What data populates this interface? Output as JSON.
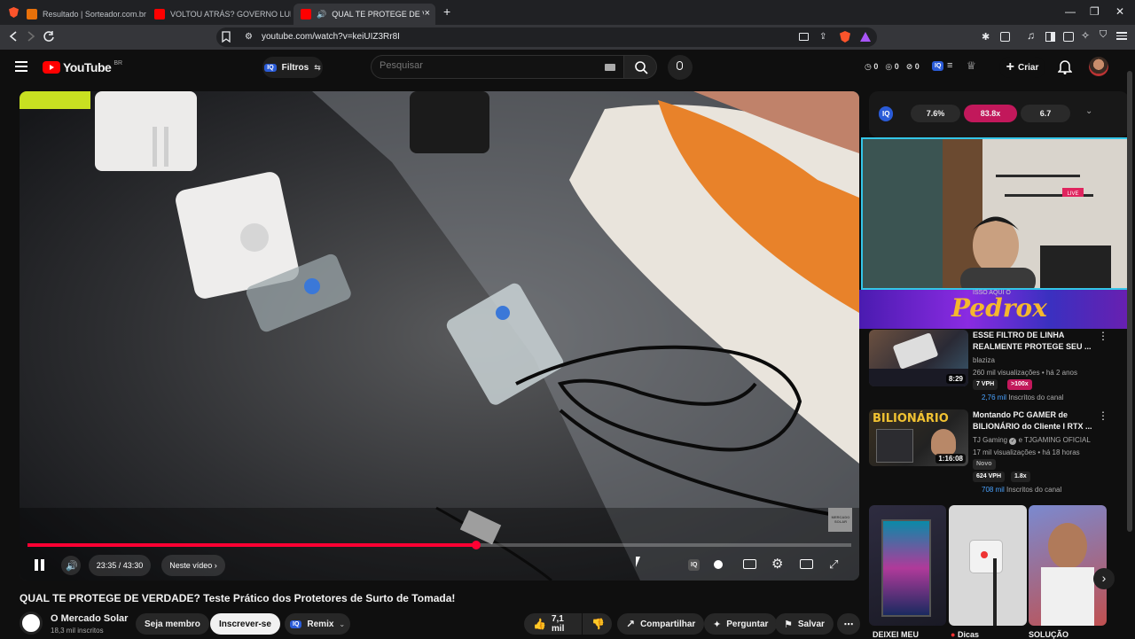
{
  "browser": {
    "tabs": [
      {
        "title": "Resultado | Sorteador.com.br - O Site",
        "active": false
      },
      {
        "title": "VOLTOU ATRÁS? GOVERNO LULA ZE",
        "active": false
      },
      {
        "title": "QUAL TE PROTEGE DE VERDA",
        "active": true
      }
    ],
    "new_tab_symbol": "+",
    "url": "youtube.com/watch?v=keiUIZ3Rr8I"
  },
  "header": {
    "logo_text": "YouTube",
    "country": "BR",
    "filters_badge": "IQ",
    "filters_label": "Filtros",
    "search_placeholder": "Pesquisar",
    "stats": [
      "0",
      "0",
      "0"
    ],
    "ext_badge": "IQ",
    "create_label": "Criar"
  },
  "video": {
    "time": "23:35 / 43:30",
    "progress": 0.545,
    "next_label": "Neste vídeo",
    "channel_watermark": "MERCADO SOLAR",
    "iq_badge": "IQ"
  },
  "below_video": {
    "title": "QUAL TE PROTEGE DE VERDADE? Teste Prático dos Protetores de Surto de Tomada!",
    "channel": "O Mercado Solar",
    "subs": "18,3 mil inscritos",
    "join_label": "Seja membro",
    "subscribe_label": "Inscrever-se",
    "remix_badge": "IQ",
    "remix_label": "Remix",
    "likes": "7,1 mil",
    "share_label": "Compartilhar",
    "ask_label": "Perguntar",
    "save_label": "Salvar"
  },
  "sidebar": {
    "iq_badge": "IQ",
    "metrics": [
      "7.6%",
      "83.8x",
      "6.7"
    ],
    "banner_text": "Pedrox",
    "banner_overlay": "ISSO AQUI O",
    "recommendations": [
      {
        "title": "ESSE FILTRO DE LINHA REALMENTE PROTEGE SEU ...",
        "channel": "blaziza",
        "meta": "260 mil visualizações • há 2 anos",
        "duration": "8:29",
        "vph": "7 VPH",
        "ratio": ">100x",
        "subs_value": "2,76 mil",
        "subs_label": " Inscritos do canal"
      },
      {
        "title": "Montando PC GAMER de BILIONÁRIO do Cliente I RTX ...",
        "channel": "TJ Gaming",
        "channel_extra": "e TJGAMING OFICIAL",
        "meta": "17 mil visualizações • há 18 horas",
        "duration": "1:16:08",
        "thumb_text": "BILIONÁRIO",
        "novo": "Novo",
        "vph": "624 VPH",
        "ratio": "1.8x",
        "subs_value": "708 mil",
        "subs_label": " Inscritos do canal"
      }
    ],
    "shorts": [
      "DEIXEI MEU",
      "Dicas",
      "SOLUÇÃO"
    ]
  },
  "colors": {
    "yt_red": "#ff0000",
    "progress_red": "#ff0033",
    "iq_blue": "#2a5bd7",
    "accent_pink": "#c2185b"
  }
}
